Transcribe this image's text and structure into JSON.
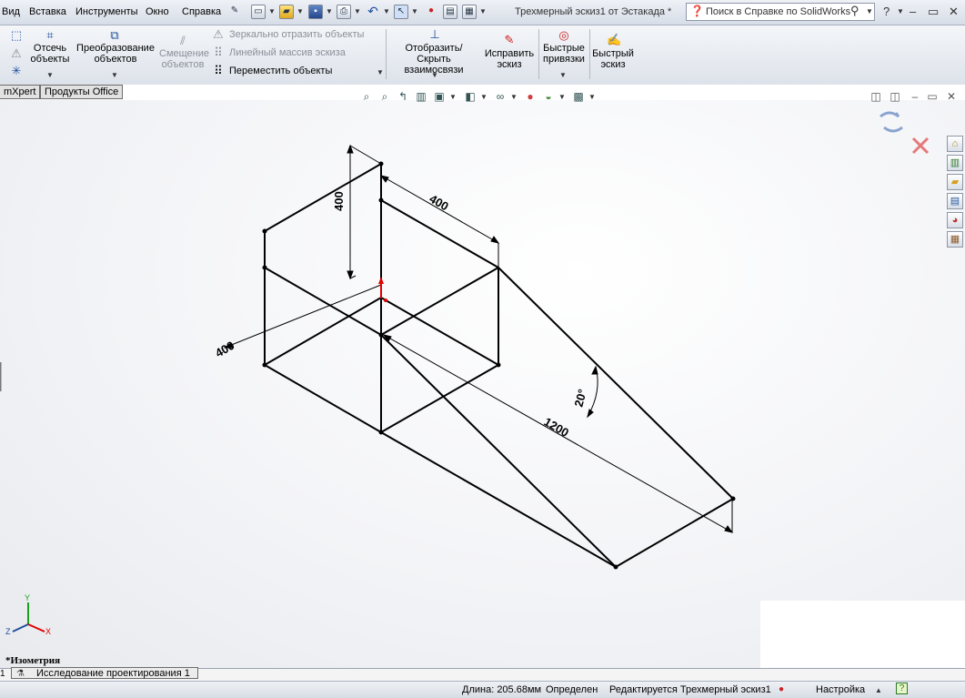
{
  "menu": {
    "items": [
      "Вид",
      "Вставка",
      "Инструменты",
      "Окно",
      "Справка"
    ]
  },
  "window_title": "Трехмерный эскиз1 от Эстакада *",
  "help_search": {
    "placeholder": "Поиск в Справке по SolidWorks"
  },
  "ribbon": {
    "trim": "Отсечь объекты",
    "convert": "Преобразование объектов",
    "offset": "Смещение объектов",
    "mirror": "Зеркально отразить объекты",
    "linear_pattern": "Линейный массив эскиза",
    "move": "Переместить объекты",
    "display_relations": "Отобразить/Скрыть взаимосвязи",
    "repair": "Исправить эскиз",
    "quick_snaps": "Быстрые привязки",
    "rapid_sketch": "Быстрый эскиз"
  },
  "tabs": [
    "mXpert",
    "Продукты Office"
  ],
  "dimensions": {
    "height": "400",
    "width": "400",
    "depth": "400",
    "length": "1200",
    "angle": "20°"
  },
  "triad": {
    "x": "X",
    "y": "Y",
    "z": "Z"
  },
  "view_name": "*Изометрия",
  "bottom_tabs": {
    "study": "Исследование проектирования 1"
  },
  "status": {
    "length": "Длина: 205.68мм",
    "state": "Определен",
    "editing": "Редактируется Трехмерный эскиз1",
    "settings": "Настройка"
  },
  "colors": {
    "accent": "#1f4e9c",
    "origin": "#e00000"
  }
}
